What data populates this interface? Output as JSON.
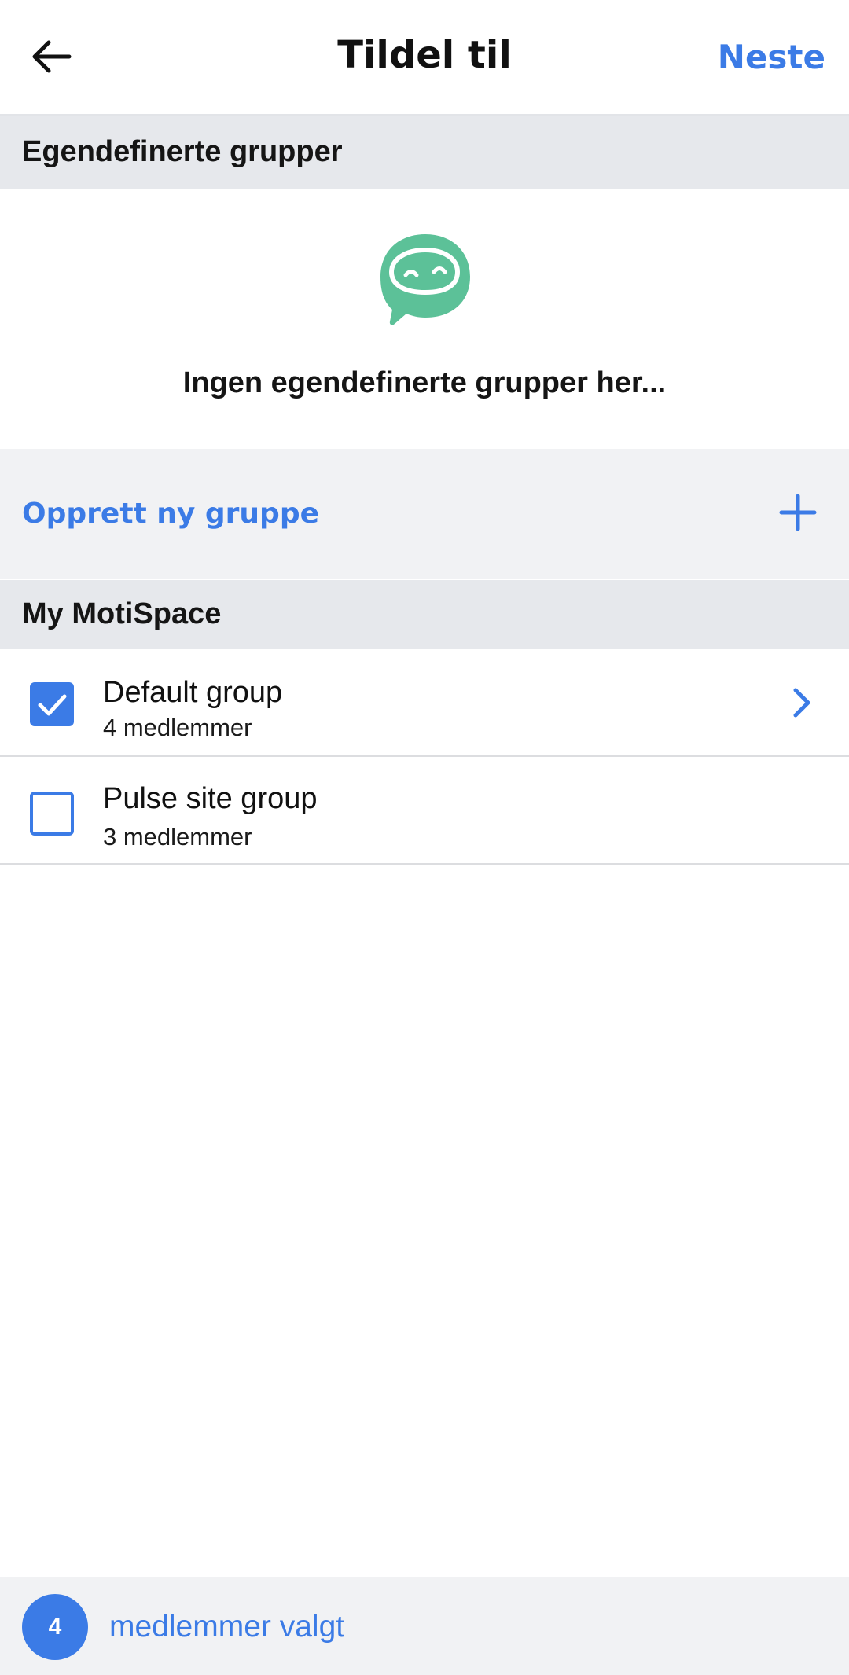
{
  "header": {
    "title": "Tildel til",
    "next_label": "Neste",
    "back_icon": "arrow-left-icon"
  },
  "custom_groups": {
    "section_title": "Egendefinerte grupper",
    "empty_text": "Ingen egendefinerte grupper her...",
    "empty_icon": "chat-bubble-mascot-icon",
    "create_label": "Opprett ny gruppe",
    "create_icon": "plus-icon"
  },
  "workspace": {
    "section_title": "My MotiSpace",
    "groups": [
      {
        "name": "Default group",
        "members": "4 medlemmer",
        "checked": true,
        "has_chevron": true
      },
      {
        "name": "Pulse site group",
        "members": "3 medlemmer",
        "checked": false,
        "has_chevron": false
      }
    ]
  },
  "footer": {
    "selected_count": "4",
    "selected_label": "medlemmer valgt"
  },
  "colors": {
    "accent": "#3b7be6",
    "mascot_green": "#5cc198",
    "section_bg": "#e6e8ec",
    "row_bg": "#f1f2f4"
  }
}
